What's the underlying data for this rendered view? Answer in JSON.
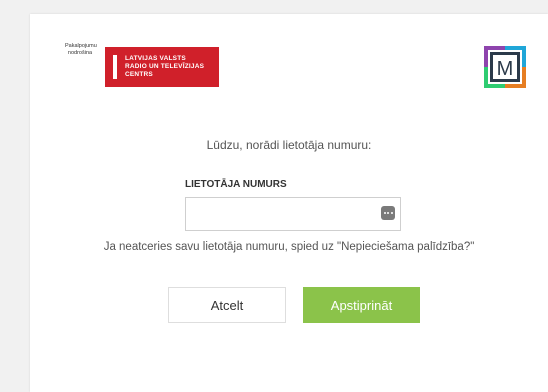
{
  "branding": {
    "provider_label_line1": "Pakalpojumu",
    "provider_label_line2": "nodrošina",
    "org_line1": "LATVIJAS VALSTS",
    "org_line2": "RADIO UN TELEVĪZIJAS",
    "org_line3": "CENTRS",
    "app_logo_letter": "M",
    "brand_red": "#d0202a"
  },
  "form": {
    "prompt": "Lūdzu, norādi lietotāja numuru:",
    "field_label": "LIETOTĀJA NUMURS",
    "field_value": "",
    "field_placeholder": "",
    "help_text": "Ja neatceries savu lietotāja numuru, spied uz \"Nepieciešama palīdzība?\""
  },
  "actions": {
    "cancel_label": "Atcelt",
    "confirm_label": "Apstiprināt",
    "confirm_color": "#8bc34a"
  }
}
